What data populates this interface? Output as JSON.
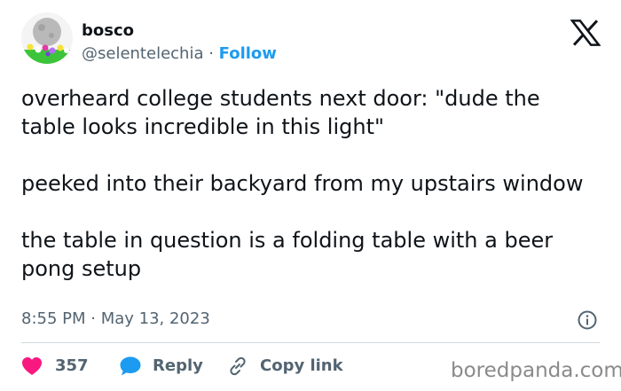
{
  "tweet": {
    "display_name": "bosco",
    "handle": "@selentelechia",
    "separator": " · ",
    "follow_label": "Follow",
    "paragraphs": [
      "overheard college students next door: \"dude the table looks incredible in this light\"",
      "peeked into their backyard from my upstairs window",
      "the table in question is a folding table with a beer pong setup"
    ],
    "timestamp": "8:55 PM · May 13, 2023",
    "likes": "357",
    "reply_label": "Reply",
    "copy_label": "Copy link"
  },
  "watermark": "boredpanda.com",
  "icons": {
    "brand": "x-logo-icon",
    "info": "info-icon",
    "like": "heart-icon",
    "reply": "speech-bubble-icon",
    "copy": "link-icon"
  },
  "colors": {
    "text": "#0f1419",
    "secondary": "#536471",
    "link_blue": "#1d9bf0",
    "like_pink": "#f91880",
    "divider": "#cfd9de"
  }
}
